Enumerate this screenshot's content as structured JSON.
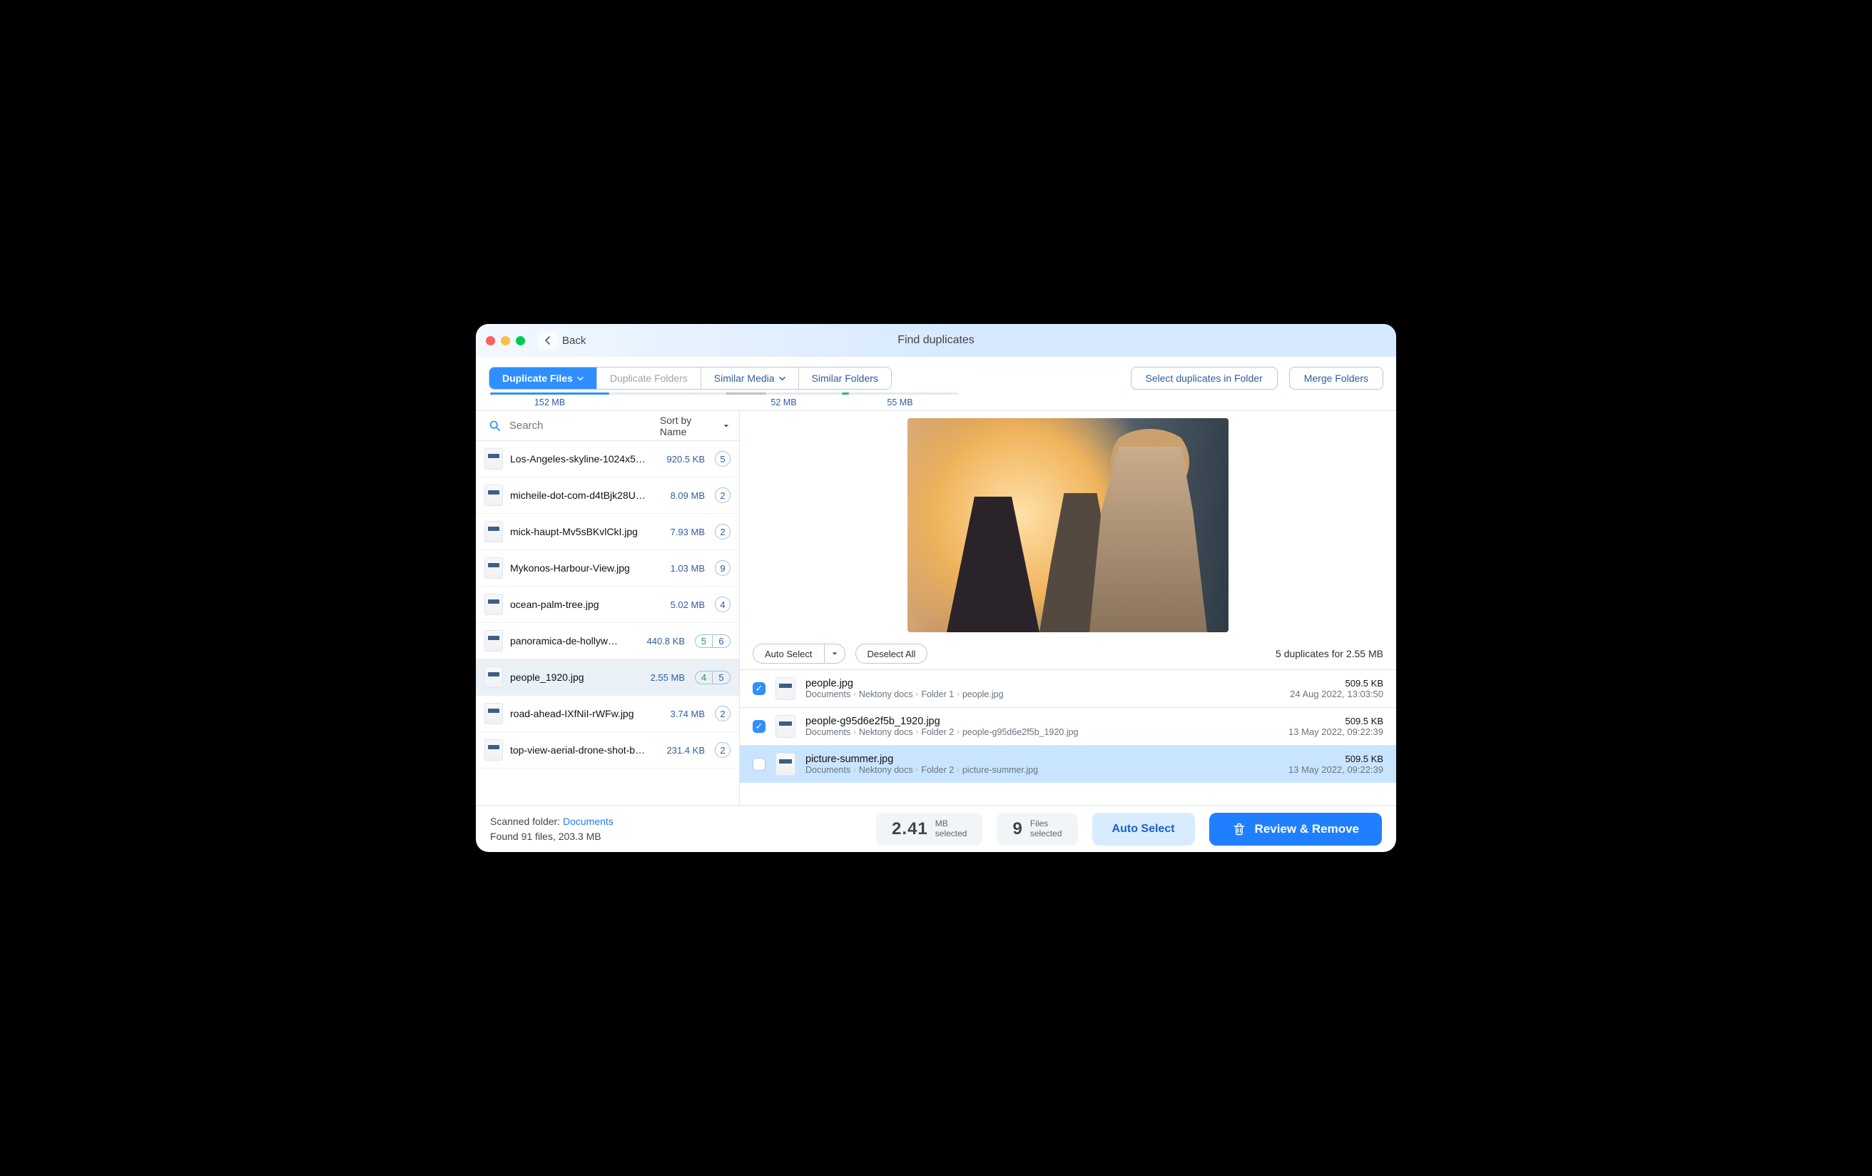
{
  "header": {
    "back_label": "Back",
    "title": "Find duplicates"
  },
  "tabs": {
    "duplicate_files": "Duplicate Files",
    "duplicate_folders": "Duplicate Folders",
    "similar_media": "Similar Media",
    "similar_folders": "Similar Folders",
    "size_files": "152 MB",
    "size_media": "52 MB",
    "size_similar_folders": "55 MB"
  },
  "toolbar": {
    "select_in_folder": "Select duplicates in Folder",
    "merge_folders": "Merge Folders"
  },
  "search": {
    "placeholder": "Search",
    "sort_label": "Sort by Name"
  },
  "files": [
    {
      "name": "Los-Angeles-skyline-1024x5…",
      "size": "920.5 KB",
      "badge": "5"
    },
    {
      "name": "micheile-dot-com-d4tBjk28U…",
      "size": "8.09 MB",
      "badge": "2"
    },
    {
      "name": "mick-haupt-Mv5sBKvlCkI.jpg",
      "size": "7.93 MB",
      "badge": "2"
    },
    {
      "name": "Mykonos-Harbour-View.jpg",
      "size": "1.03 MB",
      "badge": "9"
    },
    {
      "name": "ocean-palm-tree.jpg",
      "size": "5.02 MB",
      "badge": "4"
    },
    {
      "name": "panoramica-de-hollyw…",
      "size": "440.8 KB",
      "badge_split": [
        "5",
        "6"
      ],
      "split_colors": [
        "green",
        "blue"
      ]
    },
    {
      "name": "people_1920.jpg",
      "size": "2.55 MB",
      "badge_split": [
        "4",
        "5"
      ],
      "split_colors": [
        "green",
        "blue"
      ],
      "selected": true
    },
    {
      "name": "road-ahead-IXfNiI-rWFw.jpg",
      "size": "3.74 MB",
      "badge": "2"
    },
    {
      "name": "top-view-aerial-drone-shot-b…",
      "size": "231.4 KB",
      "badge": "2"
    }
  ],
  "preview": {
    "auto_select": "Auto Select",
    "deselect_all": "Deselect All",
    "dup_summary": "5 duplicates for 2.55 MB"
  },
  "duplicates": [
    {
      "checked": true,
      "name": "people.jpg",
      "path": [
        "Documents",
        "Nektony docs",
        "Folder 1",
        "people.jpg"
      ],
      "size": "509.5 KB",
      "date": "24 Aug 2022, 13:03:50"
    },
    {
      "checked": true,
      "name": "people-g95d6e2f5b_1920.jpg",
      "path": [
        "Documents",
        "Nektony docs",
        "Folder 2",
        "people-g95d6e2f5b_1920.jpg"
      ],
      "size": "509.5 KB",
      "date": "13 May 2022, 09:22:39"
    },
    {
      "checked": false,
      "highlight": true,
      "name": "picture-summer.jpg",
      "path": [
        "Documents",
        "Nektony docs",
        "Folder 2",
        "picture-summer.jpg"
      ],
      "size": "509.5 KB",
      "date": "13 May 2022, 09:22:39"
    }
  ],
  "footer": {
    "scanned_label": "Scanned folder: ",
    "scanned_link": "Documents",
    "found_label": "Found 91 files, 203.3 MB",
    "selected_size_value": "2.41",
    "selected_size_unit": "MB",
    "selected_size_sub": "selected",
    "selected_count_value": "9",
    "selected_count_label": "Files",
    "selected_count_sub": "selected",
    "auto_select": "Auto Select",
    "review_remove": "Review & Remove"
  }
}
